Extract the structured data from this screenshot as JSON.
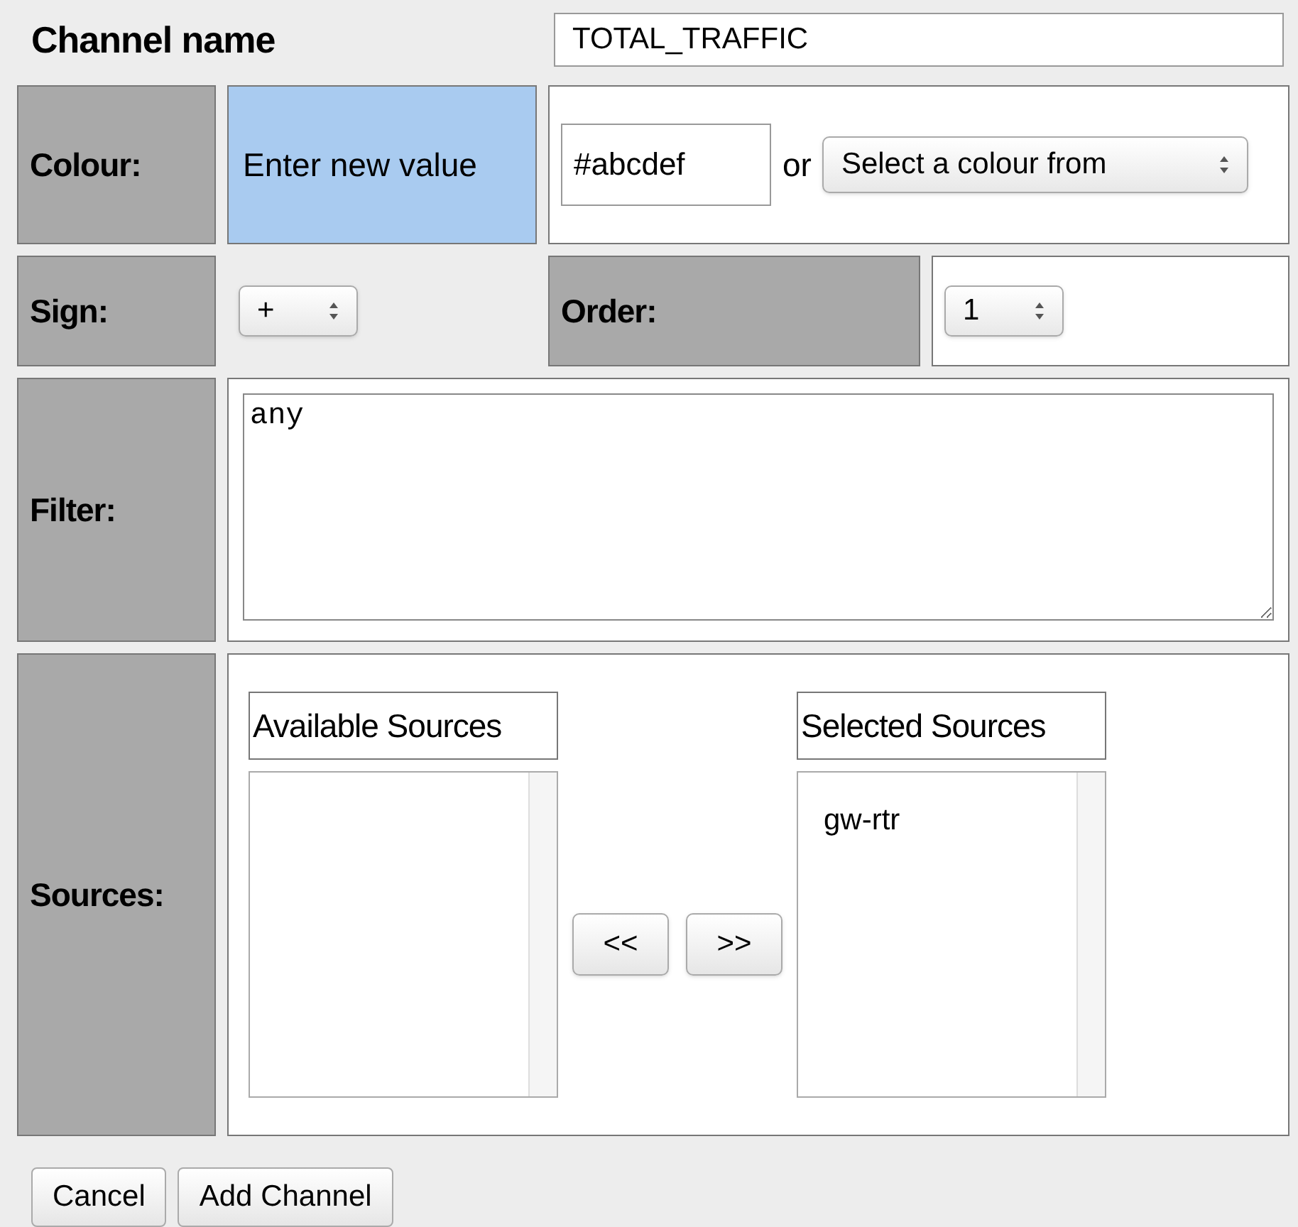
{
  "channel_name": {
    "label": "Channel name",
    "value": "TOTAL_TRAFFIC"
  },
  "colour": {
    "label": "Colour:",
    "prompt": "Enter new value",
    "value": "#abcdef",
    "connector": "or",
    "select": "Select a colour from"
  },
  "sign": {
    "label": "Sign:",
    "value": "+"
  },
  "order": {
    "label": "Order:",
    "value": "1"
  },
  "filter": {
    "label": "Filter:",
    "value": "any"
  },
  "sources": {
    "label": "Sources:",
    "available": {
      "title": "Available Sources"
    },
    "selected": {
      "title": "Selected Sources",
      "items": [
        "gw-rtr"
      ]
    },
    "move_buttons": [
      "<<",
      ">>"
    ]
  },
  "buttons": [
    "Cancel",
    "Add Channel"
  ]
}
